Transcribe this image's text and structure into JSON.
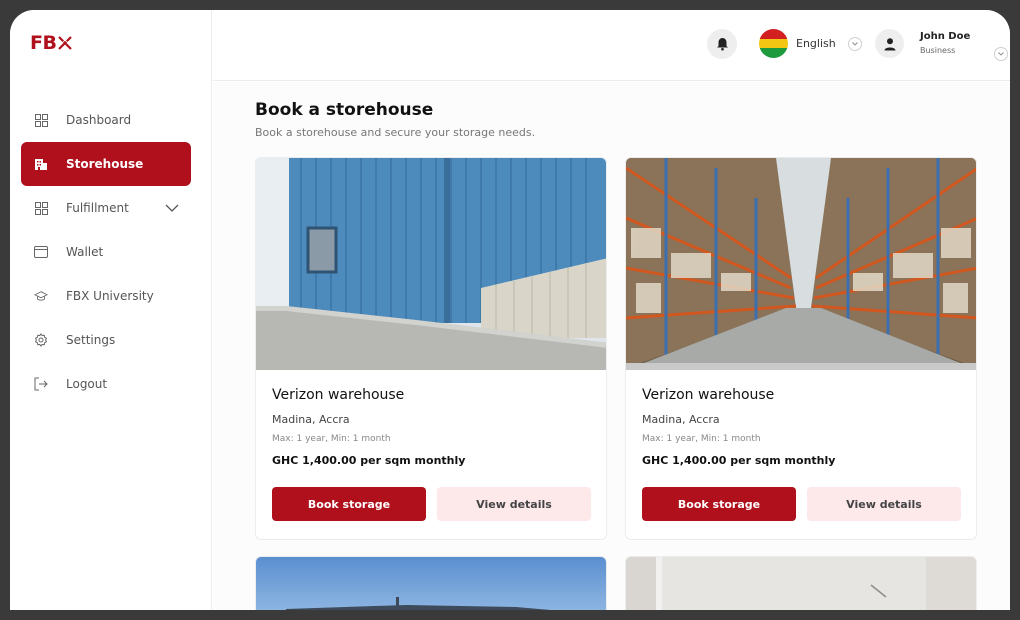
{
  "brand": {
    "logo_text": "FB",
    "accent": "#b0101c"
  },
  "sidebar": {
    "items": [
      {
        "label": "Dashboard",
        "icon": "grid-icon",
        "active": false
      },
      {
        "label": "Storehouse",
        "icon": "building-icon",
        "active": true
      },
      {
        "label": "Fulfillment",
        "icon": "grid-icon",
        "active": false,
        "expandable": true
      },
      {
        "label": "Wallet",
        "icon": "wallet-icon",
        "active": false
      },
      {
        "label": "FBX University",
        "icon": "graduation-cap-icon",
        "active": false
      },
      {
        "label": "Settings",
        "icon": "gear-icon",
        "active": false
      },
      {
        "label": "Logout",
        "icon": "logout-icon",
        "active": false
      }
    ]
  },
  "header": {
    "language": "English",
    "user": {
      "name": "John Doe",
      "role": "Business"
    }
  },
  "main": {
    "title": "Book a storehouse",
    "subtitle": "Book a storehouse and secure your storage needs.",
    "cards": [
      {
        "name": "Verizon warehouse",
        "location": "Madina, Accra",
        "duration": "Max: 1 year, Min: 1 month",
        "price": "GHC 1,400.00 per sqm monthly",
        "book_label": "Book storage",
        "details_label": "View details"
      },
      {
        "name": "Verizon warehouse",
        "location": "Madina, Accra",
        "duration": "Max: 1 year, Min: 1 month",
        "price": "GHC 1,400.00 per sqm monthly",
        "book_label": "Book storage",
        "details_label": "View details"
      }
    ]
  }
}
